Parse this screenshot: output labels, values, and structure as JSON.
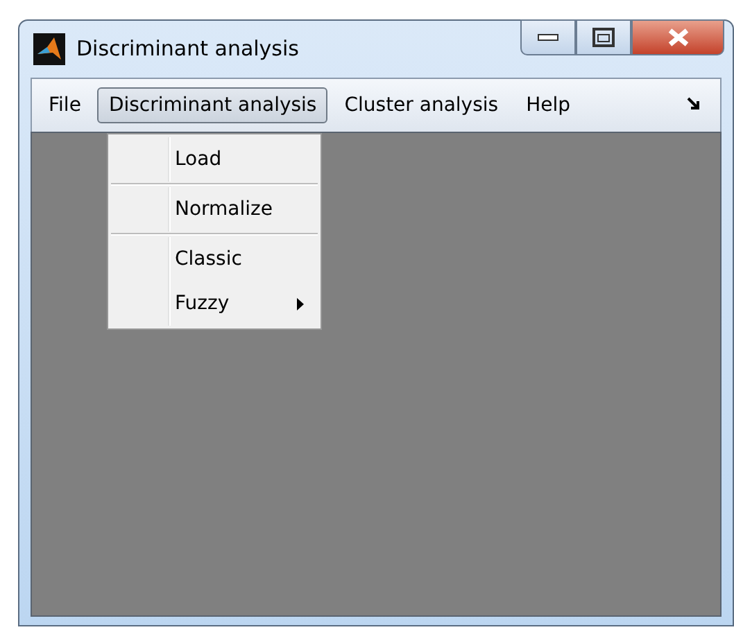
{
  "window": {
    "title": "Discriminant analysis"
  },
  "menu_bar": [
    {
      "label": "File",
      "selected": false
    },
    {
      "label": "Discriminant analysis",
      "selected": true
    },
    {
      "label": "Cluster analysis",
      "selected": false
    },
    {
      "label": "Help",
      "selected": false
    }
  ],
  "dropdown": [
    {
      "label": "Load",
      "separator_after": true,
      "submenu": false
    },
    {
      "label": "Normalize",
      "separator_after": true,
      "submenu": false
    },
    {
      "label": "Classic",
      "separator_after": false,
      "submenu": false
    },
    {
      "label": "Fuzzy",
      "separator_after": false,
      "submenu": true
    }
  ]
}
